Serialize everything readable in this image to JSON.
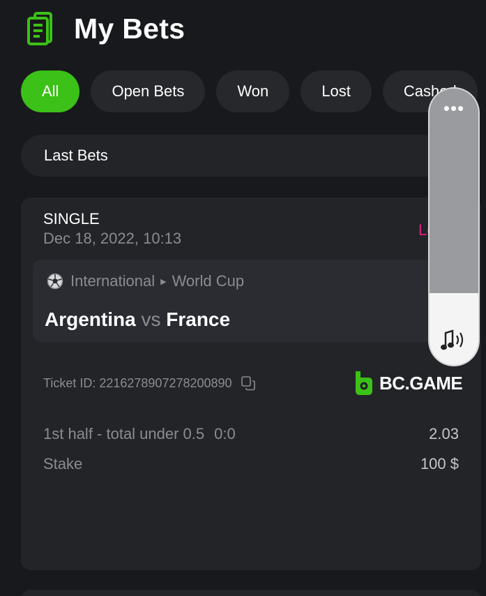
{
  "header": {
    "title": "My Bets",
    "icon": "bets-list-icon",
    "accent": "#3bc117"
  },
  "tabs": [
    {
      "label": "All",
      "active": true
    },
    {
      "label": "Open Bets",
      "active": false
    },
    {
      "label": "Won",
      "active": false
    },
    {
      "label": "Lost",
      "active": false
    },
    {
      "label": "Cashed",
      "active": false
    }
  ],
  "filter": {
    "label": "Last Bets"
  },
  "bet": {
    "type": "SINGLE",
    "date": "Dec 18, 2022, 10:13",
    "status": "Lost",
    "status_color": "#e0217a",
    "league": {
      "region": "International",
      "competition": "World Cup"
    },
    "match": {
      "home": "Argentina",
      "vs": "vs",
      "away": "France"
    },
    "ticket_id": "Ticket ID: 2216278907278200890",
    "brand": "BC.GAME",
    "market": "1st half - total under 0.5",
    "score": "0:0",
    "odds": "2.03",
    "stake_label": "Stake",
    "stake_value": "100 $"
  },
  "volume_overlay": {
    "menu": "•••",
    "level": 0.26
  }
}
